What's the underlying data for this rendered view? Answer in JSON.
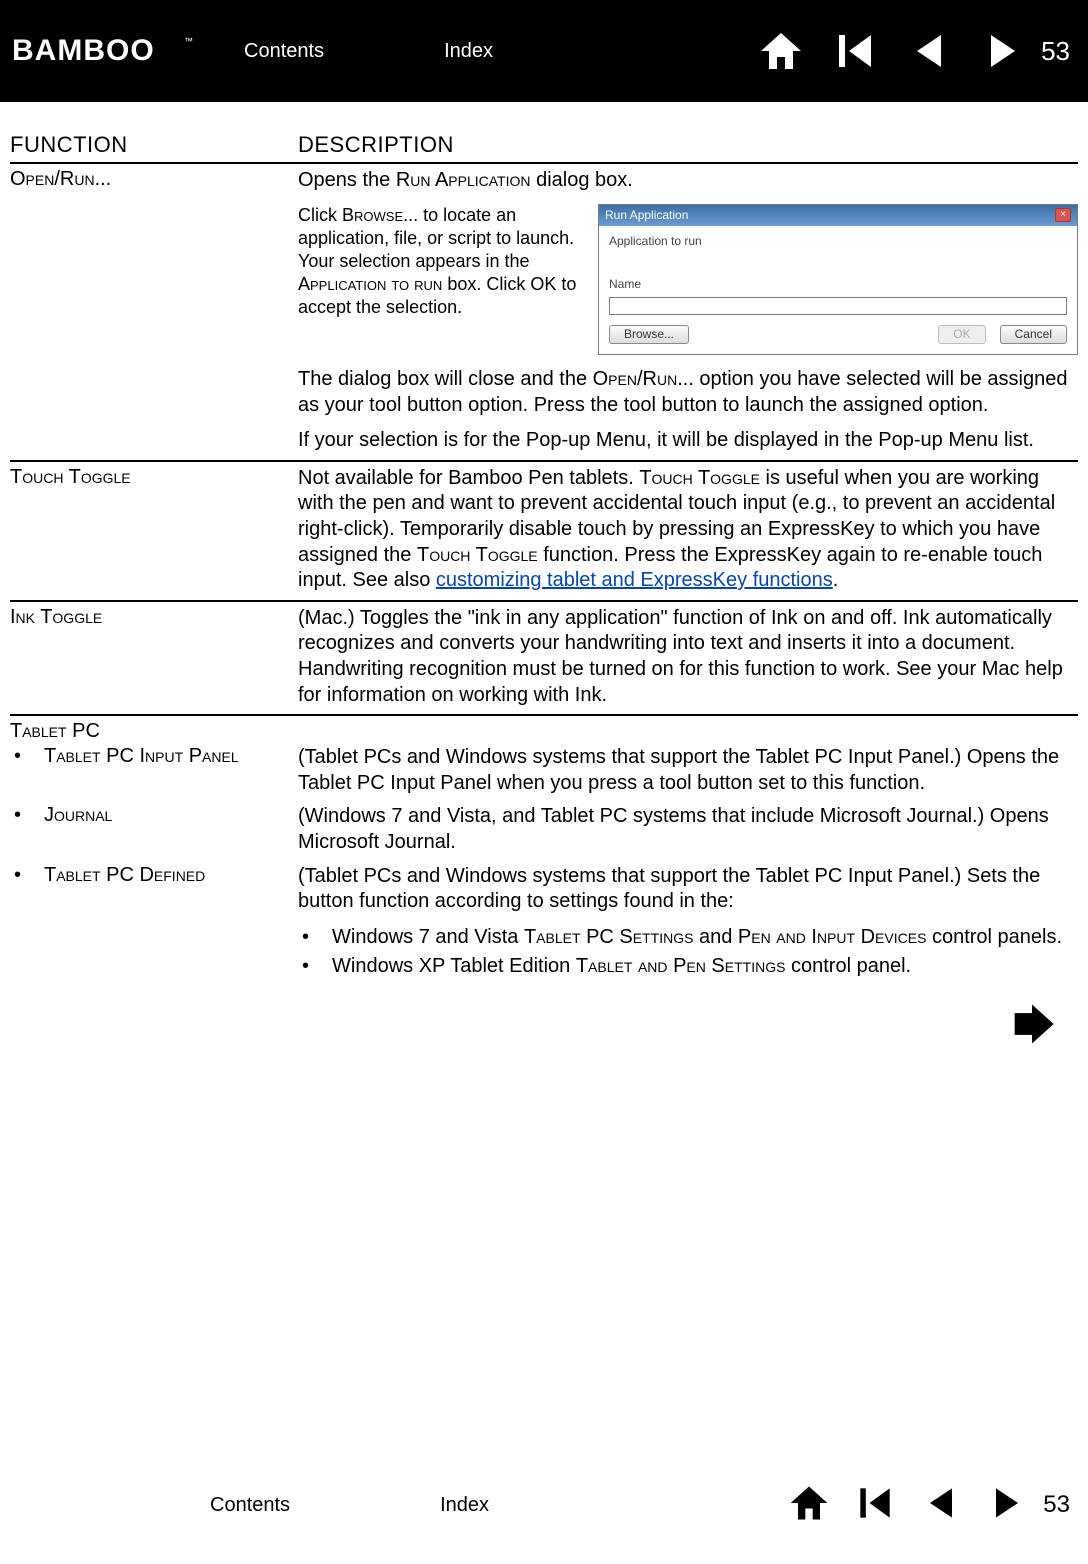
{
  "nav": {
    "contents_label": "Contents",
    "index_label": "Index",
    "page_number": "53",
    "logo_text": "BAMBOO"
  },
  "table": {
    "header_function": "FUNCTION",
    "header_description": "DESCRIPTION"
  },
  "open_run": {
    "label": "Open/Run...",
    "desc_intro": "Opens the Run Application dialog box.",
    "dialog_instructions": "Click Browse... to locate an application, file, or script to launch.  Your selection appears in the Application to run box.  Click OK to accept the selection.",
    "dialog": {
      "title": "Run Application",
      "app_to_run_label": "Application to run",
      "name_label": "Name",
      "browse_label": "Browse...",
      "ok_label": "OK",
      "cancel_label": "Cancel"
    },
    "desc_para2": "The dialog box will close and the Open/Run... option you have selected will be assigned as your tool button option.  Press the tool button to launch the assigned option.",
    "desc_para3": "If your selection is for the Pop-up Menu, it will be displayed in the Pop-up Menu list."
  },
  "touch_toggle": {
    "label": "Touch Toggle",
    "desc_prefix": "Not available for Bamboo Pen tablets.  ",
    "desc_mid1": "Touch Toggle",
    "desc_mid2": " is useful when you are working with the pen and want to prevent accidental touch input (e.g., to prevent an accidental right-click).  Temporarily disable touch by pressing an ExpressKey to which you have assigned the ",
    "desc_mid3": "Touch Toggle",
    "desc_mid4": " function.  Press the ExpressKey again to re-enable touch input.  See also ",
    "link_text": "customizing tablet and ExpressKey functions",
    "desc_end": "."
  },
  "ink_toggle": {
    "label": "Ink Toggle",
    "desc": "(Mac.)  Toggles the \"ink in any application\" function of Ink on and off.  Ink automatically recognizes and converts your handwriting into text and inserts it into a document.  Handwriting recognition must be turned on for this function to work.  See your Mac help for information on working with Ink."
  },
  "tablet_pc": {
    "header": "Tablet PC",
    "input_panel": {
      "label": "Tablet PC Input Panel",
      "desc": "(Tablet PCs and Windows systems that support the Tablet PC Input Panel.)  Opens the Tablet PC Input Panel when you press a tool button set to this function."
    },
    "journal": {
      "label": "Journal",
      "desc": "(Windows 7 and Vista, and Tablet PC systems that include Microsoft Journal.)  Opens Microsoft Journal."
    },
    "defined": {
      "label": "Tablet PC Defined",
      "desc": "(Tablet PCs and Windows systems that support the Tablet PC Input Panel.)  Sets the button function according to settings found in the:",
      "sub1_a": "Windows 7 and Vista ",
      "sub1_b": "Tablet PC Settings",
      "sub1_c": " and ",
      "sub1_d": "Pen and Input Devices",
      "sub1_e": " control panels.",
      "sub2_a": "Windows XP Tablet Edition ",
      "sub2_b": "Tablet and Pen Settings",
      "sub2_c": " control panel."
    }
  }
}
